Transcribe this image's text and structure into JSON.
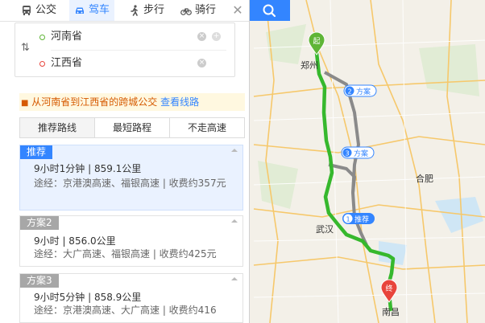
{
  "tabs": [
    {
      "label": "公交",
      "icon": "bus-icon"
    },
    {
      "label": "驾车",
      "icon": "car-icon"
    },
    {
      "label": "步行",
      "icon": "walk-icon"
    },
    {
      "label": "骑行",
      "icon": "bike-icon"
    }
  ],
  "inputs": {
    "start": "河南省",
    "end": "江西省"
  },
  "banner": {
    "text": "从河南省到江西省的跨城公交",
    "link": "查看线路"
  },
  "route_tabs": [
    "推荐路线",
    "最短路程",
    "不走高速"
  ],
  "routes": [
    {
      "header": "推荐",
      "summary": "9小时1分钟 | 859.1公里",
      "detail": "途经：京港澳高速、福银高速 | 收费约357元"
    },
    {
      "header": "方案2",
      "summary": "9小时 | 856.0公里",
      "detail": "途经：大广高速、福银高速 | 收费约425元"
    },
    {
      "header": "方案3",
      "summary": "9小时5分钟 | 858.9公里",
      "detail": "途经：京港澳高速、大广高速 | 收费约416"
    }
  ],
  "map": {
    "markers": {
      "start": "起",
      "end": "终"
    },
    "route_badges": [
      "方案",
      "方案",
      "推荐"
    ],
    "route_badge_numbers": [
      "2",
      "3",
      "1"
    ],
    "city_labels": [
      "郑州",
      "武汉",
      "南昌",
      "合肥"
    ],
    "colors": {
      "recommended": "#36b82d",
      "alternative": "#8a8a8a",
      "accent": "#3385ff",
      "start": "#5fb536",
      "end": "#e8453c"
    }
  }
}
